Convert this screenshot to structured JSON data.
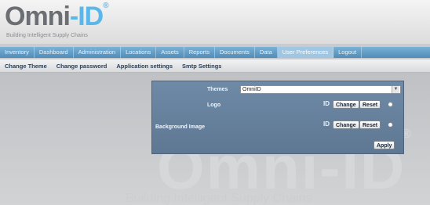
{
  "header": {
    "logo_text_main": "Omni",
    "logo_text_accent": "-ID",
    "logo_registered": "®",
    "tagline": "Building Intelligent Supply Chains"
  },
  "main_nav": {
    "items": [
      {
        "label": "Inventory"
      },
      {
        "label": "Dashboard"
      },
      {
        "label": "Administration"
      },
      {
        "label": "Locations"
      },
      {
        "label": "Assets"
      },
      {
        "label": "Reports"
      },
      {
        "label": "Documents"
      },
      {
        "label": "Data"
      },
      {
        "label": "User Preferences"
      },
      {
        "label": "Logout"
      }
    ],
    "active_index": 8
  },
  "sub_nav": {
    "items": [
      {
        "label": "Change Theme"
      },
      {
        "label": "Change password"
      },
      {
        "label": "Application settings"
      },
      {
        "label": "Smtp Settings"
      }
    ]
  },
  "settings": {
    "themes_label": "Themes",
    "theme_value": "OmniID",
    "logo_label": "Logo",
    "logo_preview": "ID",
    "background_label": "Background Image",
    "background_preview": "ID",
    "change_label": "Change",
    "reset_label": "Reset",
    "apply_label": "Apply"
  },
  "watermark": {
    "text": "Omni-ID",
    "registered": "®",
    "tagline": "Building Intelligent Supply Chains"
  },
  "colors": {
    "nav_blue": "#5b95c0",
    "panel_blue": "#67819d",
    "logo_accent": "#5bb7ea"
  }
}
